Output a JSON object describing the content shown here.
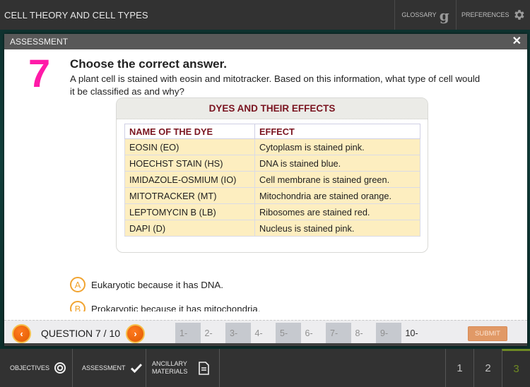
{
  "topbar": {
    "title": "CELL THEORY AND CELL TYPES",
    "glossary_label": "GLOSSARY",
    "glossary_icon": "g",
    "preferences_label": "PREFERENCES"
  },
  "modal": {
    "title": "ASSESSMENT",
    "close_icon": "✕"
  },
  "question": {
    "number": "7",
    "heading": "Choose the correct answer.",
    "text": "A plant cell is stained with eosin and mitotracker. Based on this information, what type of cell would it be classified as and why?"
  },
  "table": {
    "title": "DYES AND THEIR EFFECTS",
    "headers": [
      "NAME OF THE DYE",
      "EFFECT"
    ],
    "rows": [
      [
        "EOSIN (EO)",
        "Cytoplasm is stained pink."
      ],
      [
        "HOECHST STAIN (HS)",
        "DNA is stained blue."
      ],
      [
        "IMIDAZOLE-OSMIUM (IO)",
        "Cell membrane is stained green."
      ],
      [
        "MITOTRACKER (MT)",
        "Mitochondria are stained orange."
      ],
      [
        "LEPTOMYCIN B (LB)",
        "Ribosomes are stained red."
      ],
      [
        "DAPI (D)",
        "Nucleus is stained pink."
      ]
    ]
  },
  "options": [
    {
      "letter": "A",
      "text": "Eukaryotic because it has DNA."
    },
    {
      "letter": "B",
      "text": "Prokaryotic because it has mitochondria."
    }
  ],
  "qnav": {
    "prev_icon": "‹",
    "next_icon": "›",
    "label": "QUESTION 7 / 10",
    "pages": [
      "1-",
      "2-",
      "3-",
      "4-",
      "5-",
      "6-",
      "7-",
      "8-",
      "9-",
      "10-"
    ],
    "current_page": 10,
    "submit_label": "SUBMIT"
  },
  "footer": {
    "objectives_label": "OBJECTIVES",
    "assessment_label": "ASSESSMENT",
    "ancillary_label_1": "ANCILLARY",
    "ancillary_label_2": "MATERIALS",
    "pages": [
      "1",
      "2",
      "3"
    ],
    "active_page": "3"
  },
  "colors": {
    "accent_pink": "#ff1aa8",
    "option_orange": "#f1a431",
    "nav_orange": "#e05a00",
    "table_header_red": "#7a1420",
    "table_row_bg": "#fdeec0",
    "footer_active_green": "#6f8a23"
  }
}
